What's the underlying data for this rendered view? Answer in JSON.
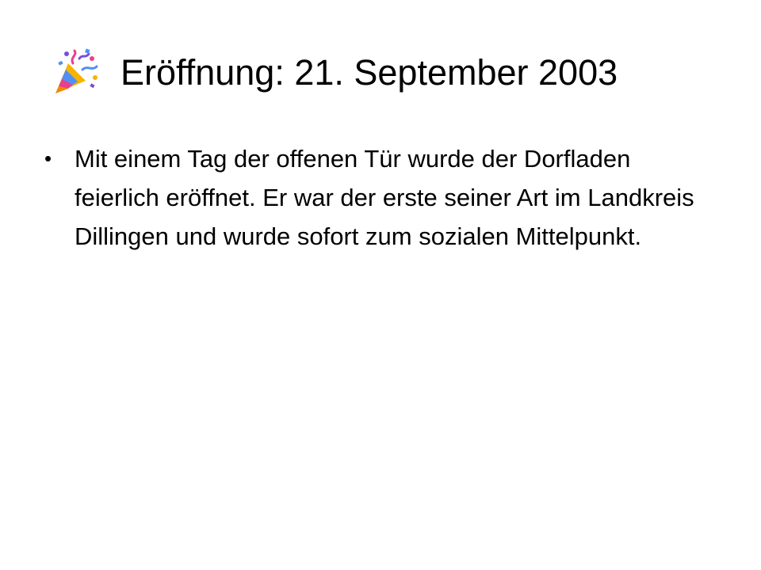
{
  "slide": {
    "title": "Eröffnung: 21. September 2003",
    "title_icon": "party-popper-icon",
    "bullets": [
      {
        "marker": "•",
        "text": "Mit einem Tag der offenen Tür wurde der Dorfladen feierlich eröffnet. Er war der erste seiner Art im Landkreis Dillingen und wurde sofort zum sozialen Mittelpunkt."
      }
    ]
  },
  "colors": {
    "background": "#ffffff",
    "text": "#000000",
    "icon_gold": "#f4b400",
    "icon_pink": "#e8418b",
    "icon_blue": "#4f8ff7",
    "icon_purple": "#7b4ddb"
  }
}
